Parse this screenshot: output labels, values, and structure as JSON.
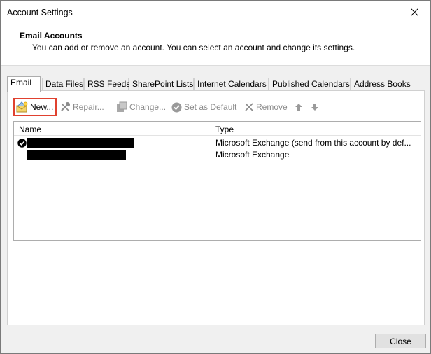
{
  "window": {
    "title": "Account Settings"
  },
  "header": {
    "title": "Email Accounts",
    "description": "You can add or remove an account. You can select an account and change its settings."
  },
  "tabs": [
    {
      "label": "Email",
      "active": true
    },
    {
      "label": "Data Files"
    },
    {
      "label": "RSS Feeds"
    },
    {
      "label": "SharePoint Lists"
    },
    {
      "label": "Internet Calendars"
    },
    {
      "label": "Published Calendars"
    },
    {
      "label": "Address Books"
    }
  ],
  "toolbar": {
    "new_label": "New...",
    "repair_label": "Repair...",
    "change_label": "Change...",
    "set_default_label": "Set as Default",
    "remove_label": "Remove"
  },
  "accounts_list": {
    "columns": {
      "name": "Name",
      "type": "Type"
    },
    "rows": [
      {
        "type": "Microsoft Exchange (send from this account by def...",
        "is_default": true
      },
      {
        "type": "Microsoft Exchange",
        "is_default": false
      }
    ]
  },
  "footer": {
    "close_label": "Close"
  },
  "colors": {
    "highlight_border": "#e0412f",
    "redaction": "#000000"
  }
}
